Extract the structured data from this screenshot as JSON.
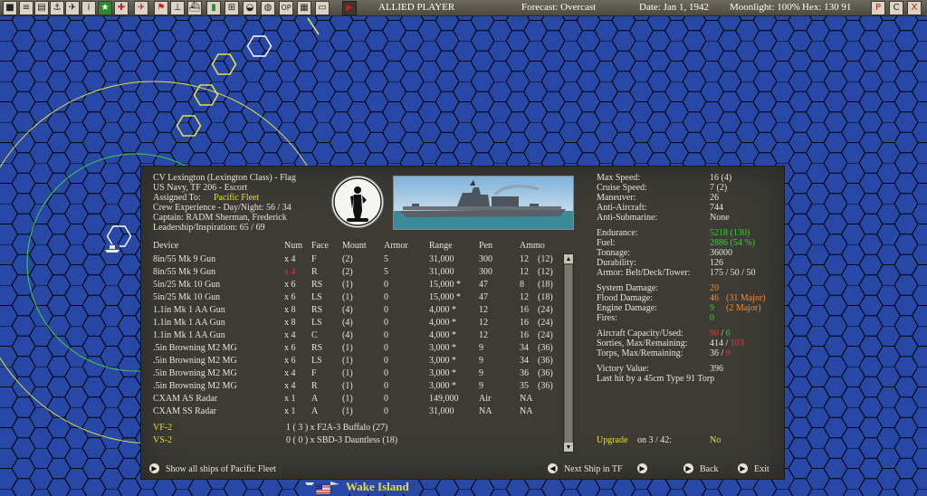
{
  "topbar": {
    "player": "ALLIED PLAYER",
    "forecast": "Forecast: Overcast",
    "date": "Date: Jan 1, 1942",
    "moonlight": "Moonlight: 100%",
    "hex": "Hex: 130 91",
    "right_icons": [
      "P",
      "C",
      "X"
    ]
  },
  "ship": {
    "name": "CV Lexington (Lexington Class) - Flag",
    "affiliation": "US Navy, TF 206 - Escort",
    "assigned_label": "Assigned To:",
    "assigned_value": "Pacific Fleet",
    "crew_exp": "Crew Experience - Day/Night:  56 / 34",
    "captain": "Captain:  RADM Sherman, Frederick",
    "leadership": "Leadership/Inspiration: 65 / 69",
    "emblem_label": "USS LEXINGTON"
  },
  "table": {
    "headers": [
      "Device",
      "Num",
      "Face",
      "Mount",
      "Armor",
      "Range",
      "Pen",
      "Ammo"
    ],
    "rows": [
      [
        "8in/55 Mk 9 Gun",
        "x 4",
        "F",
        "(2)",
        "5",
        "31,000",
        "300",
        "12",
        "(12)",
        ""
      ],
      [
        "8in/55 Mk 9 Gun",
        "x 4",
        "R",
        "(2)",
        "5",
        "31,000",
        "300",
        "12",
        "(12)",
        "r"
      ],
      [
        "5in/25 Mk 10 Gun",
        "x 6",
        "RS",
        "(1)",
        "0",
        "15,000 *",
        "47",
        "8",
        "(18)",
        ""
      ],
      [
        "5in/25 Mk 10 Gun",
        "x 6",
        "LS",
        "(1)",
        "0",
        "15,000 *",
        "47",
        "12",
        "(18)",
        ""
      ],
      [
        "1.1in Mk 1 AA Gun",
        "x 8",
        "RS",
        "(4)",
        "0",
        "4,000 *",
        "12",
        "16",
        "(24)",
        ""
      ],
      [
        "1.1in Mk 1 AA Gun",
        "x 8",
        "LS",
        "(4)",
        "0",
        "4,000 *",
        "12",
        "16",
        "(24)",
        ""
      ],
      [
        "1.1in Mk 1 AA Gun",
        "x 4",
        "C",
        "(4)",
        "0",
        "4,000 *",
        "12",
        "16",
        "(24)",
        ""
      ],
      [
        ".5in Browning M2 MG",
        "x 6",
        "RS",
        "(1)",
        "0",
        "3,000 *",
        "9",
        "34",
        "(36)",
        ""
      ],
      [
        ".5in Browning M2 MG",
        "x 6",
        "LS",
        "(1)",
        "0",
        "3,000 *",
        "9",
        "34",
        "(36)",
        ""
      ],
      [
        ".5in Browning M2 MG",
        "x 4",
        "F",
        "(1)",
        "0",
        "3,000 *",
        "9",
        "36",
        "(36)",
        ""
      ],
      [
        ".5in Browning M2 MG",
        "x 4",
        "R",
        "(1)",
        "0",
        "3,000 *",
        "9",
        "35",
        "(36)",
        ""
      ],
      [
        "CXAM AS Radar",
        "x 1",
        "A",
        "(1)",
        "0",
        "149,000",
        "Air",
        "NA",
        "",
        ""
      ],
      [
        "CXAM SS Radar",
        "x 1",
        "A",
        "(1)",
        "0",
        "31,000",
        "NA",
        "NA",
        "",
        ""
      ]
    ],
    "air_groups": [
      {
        "name": "VF-2",
        "detail": "1 ( 3 ) x F2A-3 Buffalo (27)"
      },
      {
        "name": "VS-2",
        "detail": "0 ( 0 ) x SBD-3 Dauntless (18)"
      }
    ]
  },
  "stats": {
    "max_speed_label": "Max Speed:",
    "max_speed": "16  (4)",
    "cruise_speed_label": "Cruise Speed:",
    "cruise_speed": "7  (2)",
    "maneuver_label": "Maneuver:",
    "maneuver": "26",
    "anti_aircraft_label": "Anti-Aircraft:",
    "anti_aircraft": "744",
    "anti_sub_label": "Anti-Submarine:",
    "anti_sub": "None",
    "endurance_label": "Endurance:",
    "endurance": "5218  (130)",
    "fuel_label": "Fuel:",
    "fuel": "2886  (54 %)",
    "tonnage_label": "Tonnage:",
    "tonnage": "36000",
    "durability_label": "Durability:",
    "durability": "126",
    "armor_label": "Armor: Belt/Deck/Tower:",
    "armor": "175 / 50 / 50",
    "sys_damage_label": "System Damage:",
    "sys_damage": "20",
    "flood_damage_label": "Flood Damage:",
    "flood_damage": "46",
    "flood_major": "(31 Major)",
    "engine_damage_label": "Engine Damage:",
    "engine_damage": "9",
    "engine_major": "(2 Major)",
    "fires_label": "Fires:",
    "fires": "0",
    "aircraft_cap_label": "Aircraft Capacity/Used:",
    "aircraft_cap": "90",
    "aircraft_used": "6",
    "sorties_label": "Sorties, Max/Remaining:",
    "sorties_max": "414",
    "sorties_rem": "103",
    "torps_label": "Torps, Max/Remaining:",
    "torps_max": "36",
    "torps_rem": "0",
    "victory_label": "Victory Value:",
    "victory": "396",
    "last_hit": "Last hit by a   45cm Type 91 Torp",
    "upgrade_label": "Upgrade",
    "upgrade_on": "on  3 / 42:",
    "upgrade_value": "No"
  },
  "footer": {
    "show_all": "Show all ships of Pacific Fleet",
    "next_ship": "Next Ship in TF",
    "back": "Back",
    "exit": "Exit"
  },
  "map": {
    "location_label": "Wake Island"
  },
  "colors": {
    "ocean": "#2848a8",
    "hex_line": "#000000",
    "highlight_yellow": "#eedc30",
    "green": "#30d830",
    "orange": "#ff8828",
    "red": "#ff3030"
  }
}
